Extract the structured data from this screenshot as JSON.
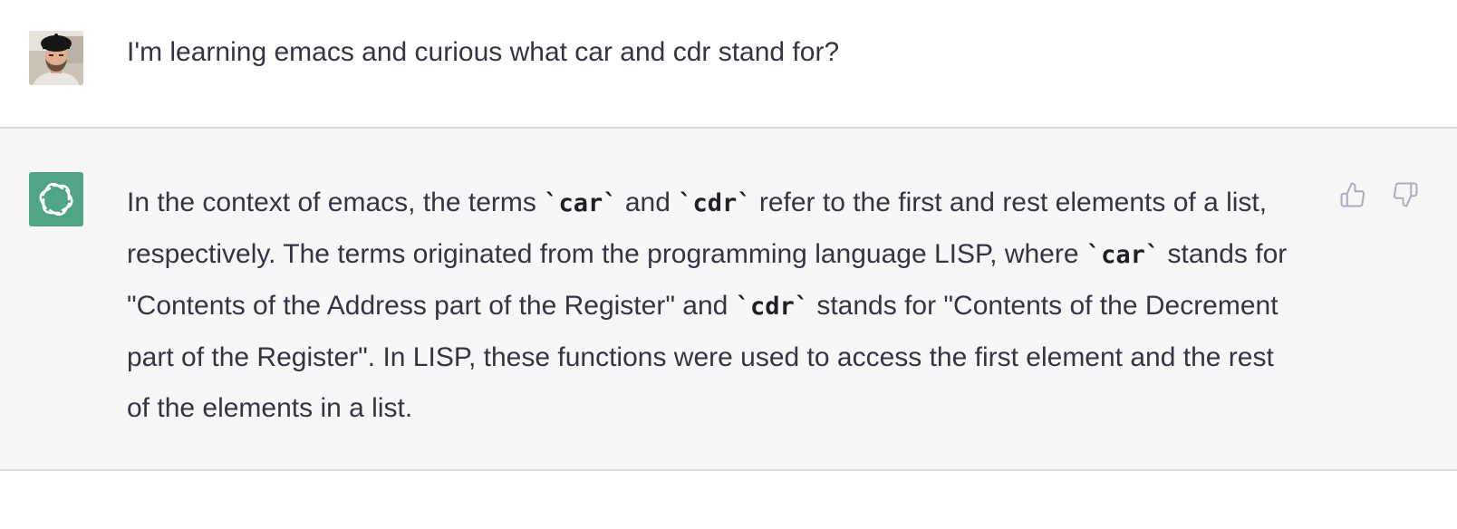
{
  "messages": [
    {
      "role": "user",
      "avatar": "user-photo",
      "text": "I'm learning emacs and curious what car and cdr stand for?"
    },
    {
      "role": "assistant",
      "avatar": "openai-logo-icon",
      "segments": [
        "In the context of emacs, the terms ",
        "`car`",
        " and ",
        "`cdr`",
        " refer to the first and rest elements of a list, respectively. The terms originated from the programming language LISP, where ",
        "`car`",
        " stands for \"Contents of the Address part of the Register\" and ",
        "`cdr`",
        " stands for \"Contents of the Decrement part of the Register\". In LISP, these functions were used to access the first element and the rest of the elements in a list."
      ],
      "feedback": {
        "thumbs_up_icon": "thumbs-up-icon",
        "thumbs_down_icon": "thumbs-down-icon"
      }
    }
  ],
  "colors": {
    "text": "#343541",
    "assistant_bg": "#f7f7f8",
    "divider": "#dcdce0",
    "bot_avatar_bg": "#4fa584",
    "icon_gray": "#acacbe"
  }
}
